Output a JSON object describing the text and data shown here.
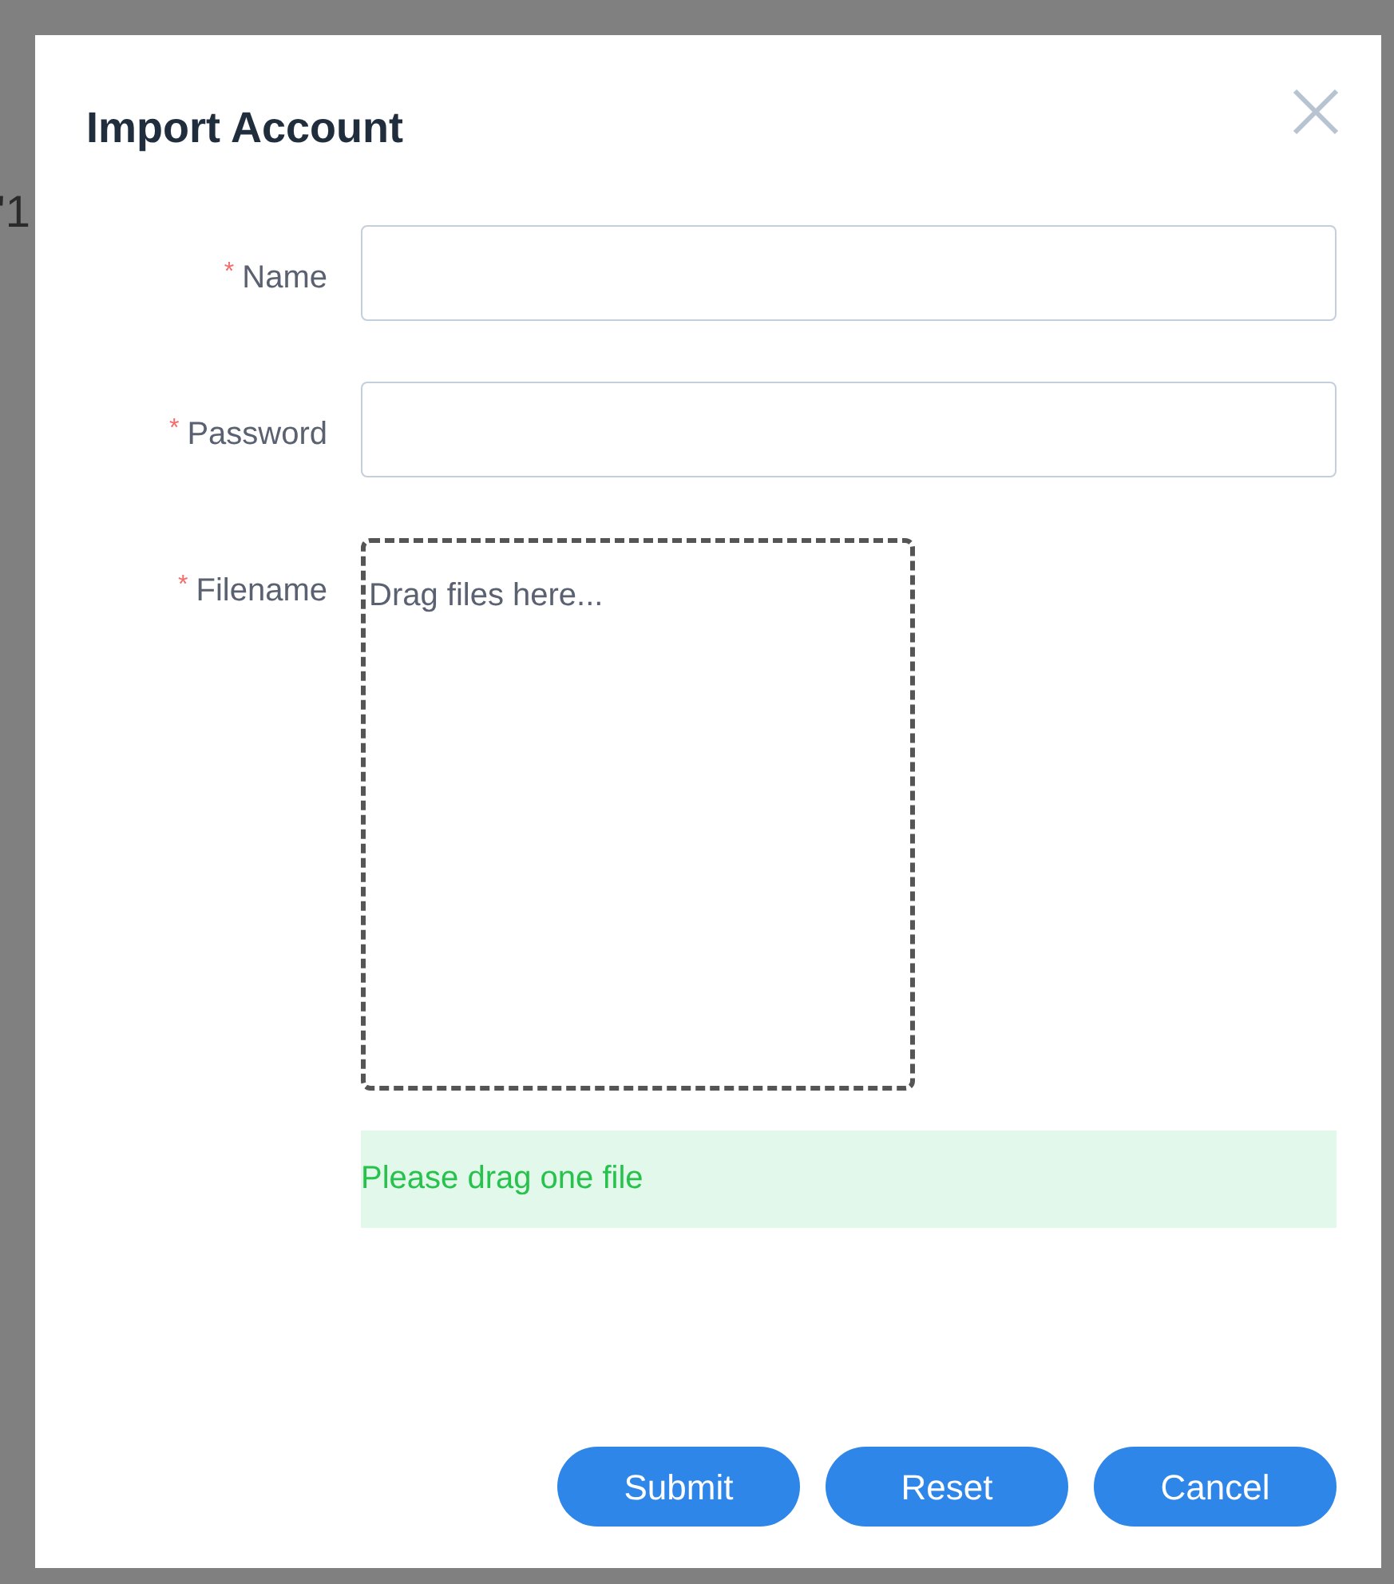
{
  "background": {
    "text": "'1"
  },
  "dialog": {
    "title": "Import Account",
    "fields": [
      {
        "kind": "input",
        "label": "Name",
        "required_mark": "*"
      },
      {
        "kind": "input",
        "label": "Password",
        "required_mark": "*"
      },
      {
        "kind": "dropzone",
        "label": "Filename",
        "required_mark": "*",
        "placeholder": "Drag files here..."
      }
    ],
    "message": "Please drag one file",
    "buttons": [
      "Submit",
      "Reset",
      "Cancel"
    ]
  }
}
